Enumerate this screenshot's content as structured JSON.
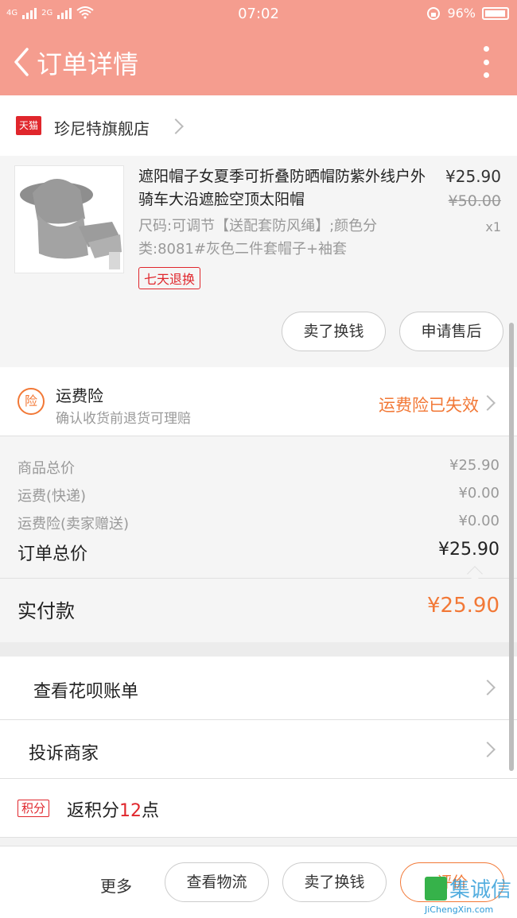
{
  "status_bar": {
    "carrier1": "4G",
    "carrier2": "2G",
    "time": "07:02",
    "battery": "96%"
  },
  "navbar": {
    "title": "订单详情"
  },
  "shop": {
    "badge": "天猫",
    "name": "珍尼特旗舰店"
  },
  "product": {
    "title": "遮阳帽子女夏季可折叠防晒帽防紫外线户外骑车大沿遮脸空顶太阳帽",
    "sku": "尺码:可调节【送配套防风绳】;颜色分类:8081#灰色二件套帽子+袖套",
    "price": "¥25.90",
    "original_price": "¥50.00",
    "quantity": "x1",
    "tag": "七天退换",
    "sell_button": "卖了换钱",
    "after_sale_button": "申请售后"
  },
  "insurance": {
    "icon_text": "险",
    "title": "运费险",
    "subtitle": "确认收货前退货可理赔",
    "status": "运费险已失效"
  },
  "summary": {
    "rows": [
      {
        "label": "商品总价",
        "value": "¥25.90"
      },
      {
        "label": "运费(快递)",
        "value": "¥0.00"
      },
      {
        "label": "运费险(卖家赠送)",
        "value": "¥0.00"
      }
    ],
    "total_label": "订单总价",
    "total_value": "¥25.90",
    "paid_label": "实付款",
    "paid_value": "¥25.90"
  },
  "links": {
    "huabei": "查看花呗账单",
    "complain": "投诉商家"
  },
  "points": {
    "badge": "积分",
    "prefix": "返积分",
    "count": "12",
    "suffix": "点"
  },
  "footer": {
    "more": "更多",
    "logistics": "查看物流",
    "sell": "卖了换钱",
    "review": "评价"
  },
  "watermark": {
    "text": "集诚信",
    "url": "JiChengXin.com"
  },
  "colors": {
    "header": "#f59d8f",
    "accent": "#f27836",
    "tmall_red": "#e0262c"
  }
}
